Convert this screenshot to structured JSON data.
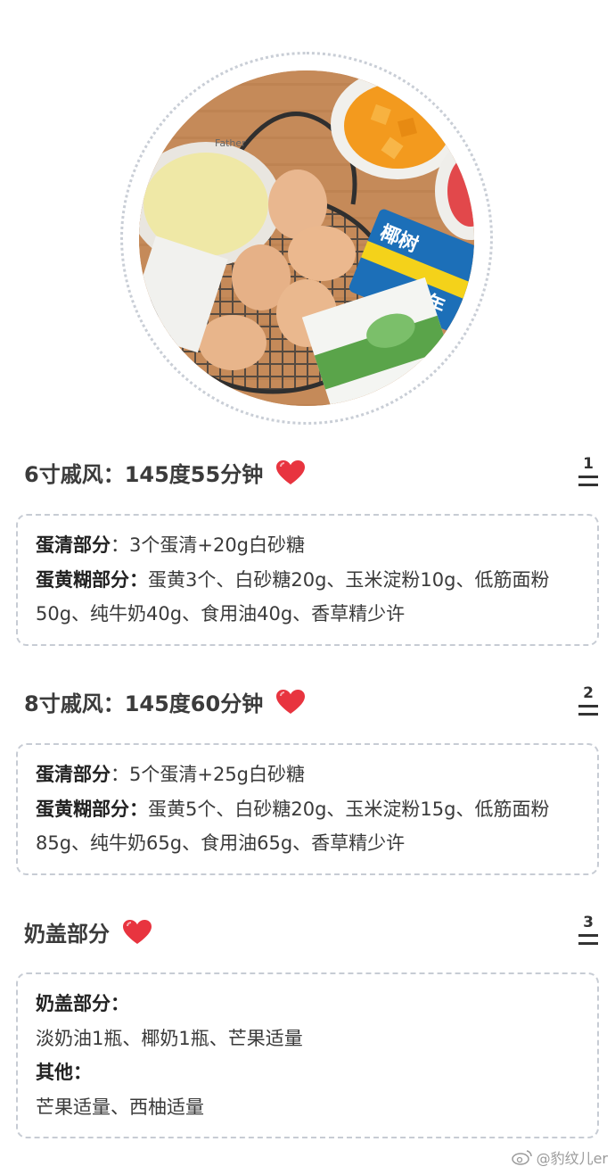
{
  "sections": [
    {
      "title": "6寸戚风：145度55分钟",
      "step": "1",
      "card": {
        "line1_label": "蛋清部分",
        "line1_sep": "：",
        "line1_text": "3个蛋清+20g白砂糖",
        "line2_label": "蛋黄糊部分",
        "line2_sep": "：",
        "line2_text": "蛋黄3个、白砂糖20g、玉米淀粉10g、低筋面粉50g、纯牛奶40g、食用油40g、香草精少许"
      }
    },
    {
      "title": "8寸戚风：145度60分钟",
      "step": "2",
      "card": {
        "line1_label": "蛋清部分",
        "line1_sep": "：",
        "line1_text": "5个蛋清+25g白砂糖",
        "line2_label": "蛋黄糊部分",
        "line2_sep": "：",
        "line2_text": "蛋黄5个、白砂糖20g、玉米淀粉15g、低筋面粉85g、纯牛奶65g、食用油65g、香草精少许"
      }
    },
    {
      "title": "奶盖部分",
      "step": "3",
      "card": {
        "label1": "奶盖部分：",
        "text1": "淡奶油1瓶、椰奶1瓶、芒果适量",
        "label2": "其他：",
        "text2": "芒果适量、西柚适量"
      }
    }
  ],
  "photo": {
    "bowl_text": "Father",
    "can_text_1": "椰树",
    "can_text_2": "31年"
  },
  "watermark": "@豹纹儿er",
  "colors": {
    "heart": "#e8343f",
    "dashed_border": "#c7ccd4",
    "table_wood": "#c98f5e",
    "mango": "#f39a1e"
  }
}
